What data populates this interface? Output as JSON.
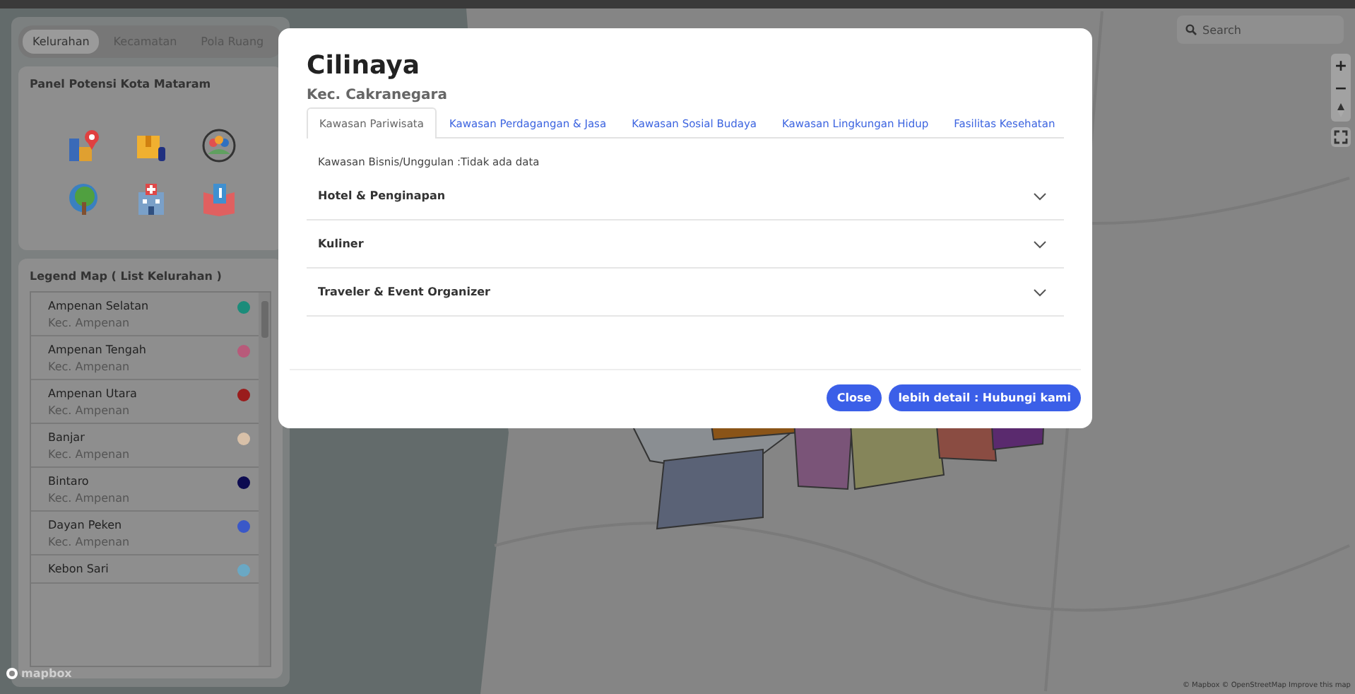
{
  "sidebar": {
    "view_tabs": [
      {
        "label": "Kelurahan",
        "selected": true
      },
      {
        "label": "Kecamatan",
        "selected": false
      },
      {
        "label": "Pola Ruang",
        "selected": false
      }
    ],
    "potensi_panel": {
      "title": "Panel Potensi Kota Mataram"
    },
    "legend": {
      "title": "Legend Map ( List Kelurahan )",
      "items": [
        {
          "name": "Ampenan Selatan",
          "district": "Kec. Ampenan",
          "color": "#1b8c7a"
        },
        {
          "name": "Ampenan Tengah",
          "district": "Kec. Ampenan",
          "color": "#b85a7a"
        },
        {
          "name": "Ampenan Utara",
          "district": "Kec. Ampenan",
          "color": "#9a1c1c"
        },
        {
          "name": "Banjar",
          "district": "Kec. Ampenan",
          "color": "#d8c0a8"
        },
        {
          "name": "Bintaro",
          "district": "Kec. Ampenan",
          "color": "#0d0b50"
        },
        {
          "name": "Dayan Peken",
          "district": "Kec. Ampenan",
          "color": "#3a58c8"
        },
        {
          "name": "Kebon Sari",
          "color": "#6aa8c4"
        }
      ]
    }
  },
  "map": {
    "search": {
      "placeholder": "Search"
    },
    "zoom_in": "+",
    "zoom_out": "−",
    "logo": "mapbox",
    "attribution": "© Mapbox © OpenStreetMap Improve this map"
  },
  "modal": {
    "title": "Cilinaya",
    "subtitle": "Kec. Cakranegara",
    "tabs": [
      {
        "label": "Kawasan Pariwisata",
        "selected": true
      },
      {
        "label": "Kawasan Perdagangan & Jasa",
        "selected": false
      },
      {
        "label": "Kawasan Sosial Budaya",
        "selected": false
      },
      {
        "label": "Kawasan Lingkungan Hidup",
        "selected": false
      },
      {
        "label": "Fasilitas Kesehatan",
        "selected": false
      }
    ],
    "info": "Kawasan Bisnis/Unggulan :Tidak ada data",
    "sections": [
      {
        "title": "Hotel & Penginapan",
        "expanded": false
      },
      {
        "title": "Kuliner",
        "expanded": false
      },
      {
        "title": "Traveler & Event Organizer",
        "expanded": false
      }
    ],
    "buttons": [
      "Close",
      "lebih detail : Hubungi kami"
    ]
  }
}
